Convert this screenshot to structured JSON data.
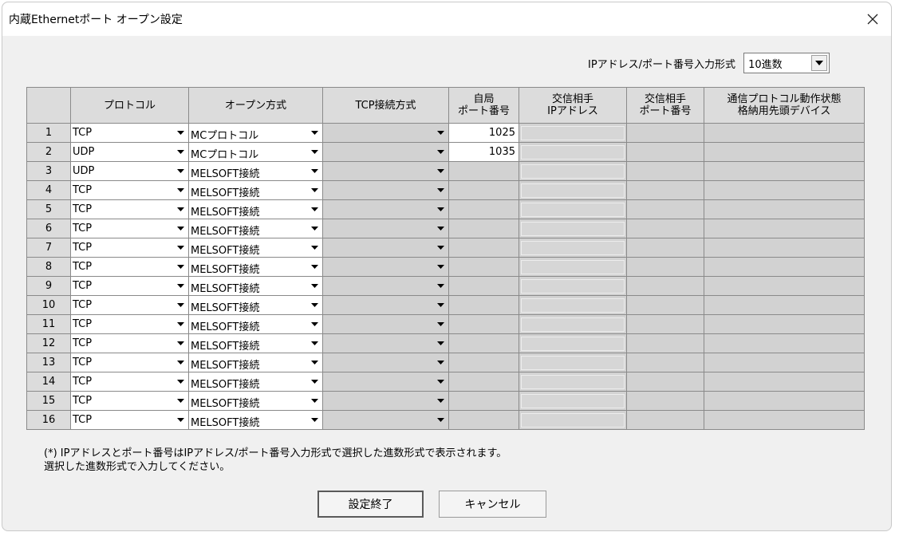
{
  "window": {
    "title": "内蔵Ethernetポート オープン設定",
    "close_icon": "close-icon"
  },
  "format": {
    "label": "IPアドレス/ポート番号入力形式",
    "selected": "10進数"
  },
  "table": {
    "headers": {
      "protocol": "プロトコル",
      "open_method": "オープン方式",
      "tcp_method": "TCP接続方式",
      "local_port_1": "自局",
      "local_port_2": "ポート番号",
      "remote_ip_1": "交信相手",
      "remote_ip_2": "IPアドレス",
      "remote_port_1": "交信相手",
      "remote_port_2": "ポート番号",
      "device_1": "通信プロトコル動作状態",
      "device_2": "格納用先頭デバイス"
    },
    "rows": [
      {
        "no": "1",
        "protocol": "TCP",
        "open_method": "MCプロトコル",
        "tcp_method": "",
        "local_port": "1025"
      },
      {
        "no": "2",
        "protocol": "UDP",
        "open_method": "MCプロトコル",
        "tcp_method": "",
        "local_port": "1035"
      },
      {
        "no": "3",
        "protocol": "UDP",
        "open_method": "MELSOFT接続",
        "tcp_method": "",
        "local_port": ""
      },
      {
        "no": "4",
        "protocol": "TCP",
        "open_method": "MELSOFT接続",
        "tcp_method": "",
        "local_port": ""
      },
      {
        "no": "5",
        "protocol": "TCP",
        "open_method": "MELSOFT接続",
        "tcp_method": "",
        "local_port": ""
      },
      {
        "no": "6",
        "protocol": "TCP",
        "open_method": "MELSOFT接続",
        "tcp_method": "",
        "local_port": ""
      },
      {
        "no": "7",
        "protocol": "TCP",
        "open_method": "MELSOFT接続",
        "tcp_method": "",
        "local_port": ""
      },
      {
        "no": "8",
        "protocol": "TCP",
        "open_method": "MELSOFT接続",
        "tcp_method": "",
        "local_port": ""
      },
      {
        "no": "9",
        "protocol": "TCP",
        "open_method": "MELSOFT接続",
        "tcp_method": "",
        "local_port": ""
      },
      {
        "no": "10",
        "protocol": "TCP",
        "open_method": "MELSOFT接続",
        "tcp_method": "",
        "local_port": ""
      },
      {
        "no": "11",
        "protocol": "TCP",
        "open_method": "MELSOFT接続",
        "tcp_method": "",
        "local_port": ""
      },
      {
        "no": "12",
        "protocol": "TCP",
        "open_method": "MELSOFT接続",
        "tcp_method": "",
        "local_port": ""
      },
      {
        "no": "13",
        "protocol": "TCP",
        "open_method": "MELSOFT接続",
        "tcp_method": "",
        "local_port": ""
      },
      {
        "no": "14",
        "protocol": "TCP",
        "open_method": "MELSOFT接続",
        "tcp_method": "",
        "local_port": ""
      },
      {
        "no": "15",
        "protocol": "TCP",
        "open_method": "MELSOFT接続",
        "tcp_method": "",
        "local_port": ""
      },
      {
        "no": "16",
        "protocol": "TCP",
        "open_method": "MELSOFT接続",
        "tcp_method": "",
        "local_port": ""
      }
    ]
  },
  "note": {
    "line1": "(*) IPアドレスとポート番号はIPアドレス/ポート番号入力形式で選択した進数形式で表示されます。",
    "line2": "選択した進数形式で入力してください。"
  },
  "buttons": {
    "ok": "設定終了",
    "cancel": "キャンセル"
  }
}
